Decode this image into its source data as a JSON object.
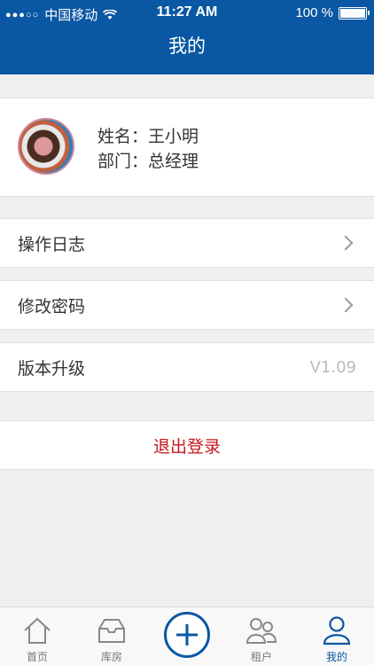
{
  "status_bar": {
    "carrier": "中国移动",
    "time": "11:27 AM",
    "battery": "100 %"
  },
  "nav": {
    "title": "我的"
  },
  "profile": {
    "name_line": "姓名：王小明",
    "dept_line": "部门：总经理"
  },
  "menu": {
    "log": "操作日志",
    "password": "修改密码",
    "upgrade": "版本升级",
    "version": "V1.09"
  },
  "logout": {
    "label": "退出登录"
  },
  "tabs": [
    {
      "label": "首页"
    },
    {
      "label": "库房"
    },
    {
      "label": ""
    },
    {
      "label": "租户"
    },
    {
      "label": "我的"
    }
  ],
  "colors": {
    "brand": "#0a57a3",
    "danger": "#c8161d"
  }
}
